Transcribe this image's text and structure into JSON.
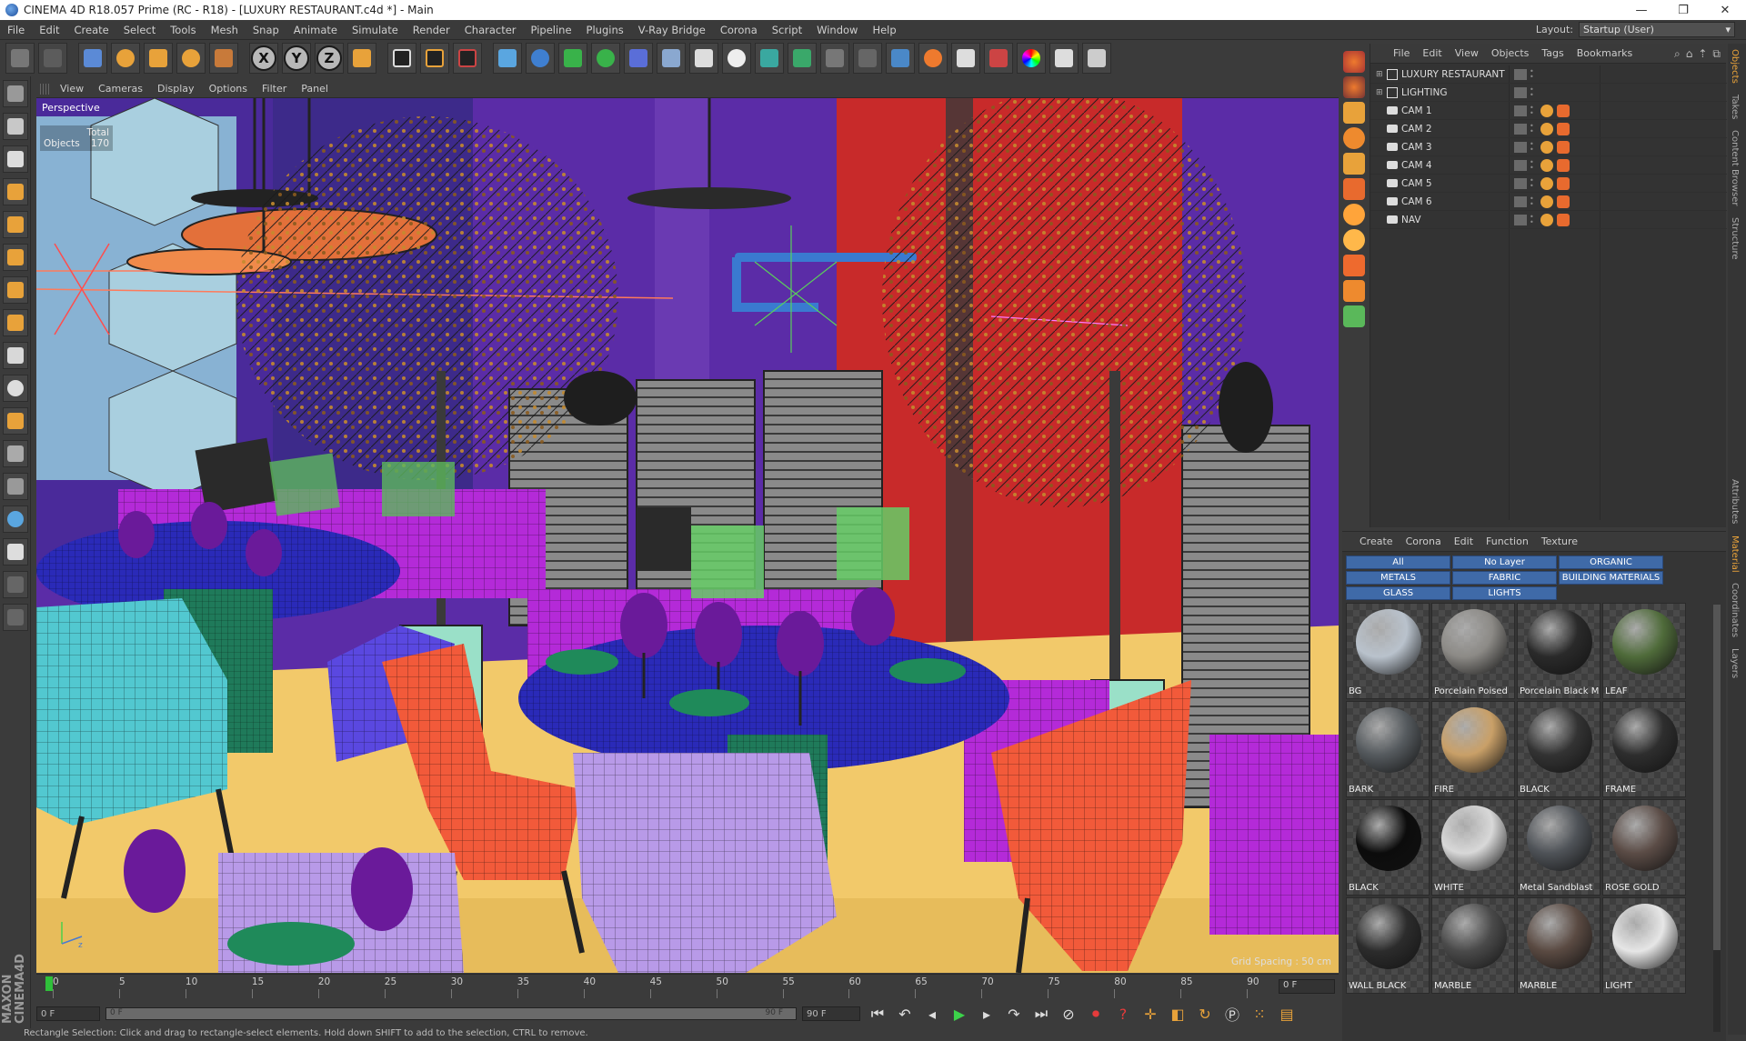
{
  "window": {
    "title": "CINEMA 4D R18.057 Prime (RC - R18) - [LUXURY RESTAURANT.c4d *] - Main",
    "min_glyph": "—",
    "max_glyph": "❐",
    "close_glyph": "✕"
  },
  "menubar": {
    "items": [
      "File",
      "Edit",
      "Create",
      "Select",
      "Tools",
      "Mesh",
      "Snap",
      "Animate",
      "Simulate",
      "Render",
      "Character",
      "Pipeline",
      "Plugins",
      "V-Ray Bridge",
      "Corona",
      "Script",
      "Window",
      "Help"
    ],
    "layout_label": "Layout:",
    "layout_value": "Startup (User)"
  },
  "toolbar": {
    "axis_x": "X",
    "axis_y": "Y",
    "axis_z": "Z"
  },
  "viewport": {
    "menu": [
      "View",
      "Cameras",
      "Display",
      "Options",
      "Filter",
      "Panel"
    ],
    "camera_label": "Perspective",
    "stats_total_label": "Total",
    "stats_objects_label": "Objects",
    "stats_objects_value": "170",
    "grid_spacing": "Grid Spacing : 50 cm"
  },
  "timeline": {
    "ticks": [
      "0",
      "5",
      "10",
      "15",
      "20",
      "25",
      "30",
      "35",
      "40",
      "45",
      "50",
      "55",
      "60",
      "65",
      "70",
      "75",
      "80",
      "85",
      "90"
    ],
    "current_frame": "0 F",
    "start_field": "0 F",
    "range_start": "0 F",
    "range_end": "90 F",
    "end_field": "90 F"
  },
  "status_text": "Rectangle Selection: Click and drag to rectangle-select elements. Hold down SHIFT to add to the selection, CTRL to remove.",
  "object_manager": {
    "menu": [
      "File",
      "Edit",
      "View",
      "Objects",
      "Tags",
      "Bookmarks"
    ],
    "objects": [
      {
        "name": "LUXURY RESTAURANT",
        "type": "null"
      },
      {
        "name": "LIGHTING",
        "type": "null"
      },
      {
        "name": "CAM 1",
        "type": "camera"
      },
      {
        "name": "CAM 2",
        "type": "camera"
      },
      {
        "name": "CAM 3",
        "type": "camera"
      },
      {
        "name": "CAM 4",
        "type": "camera"
      },
      {
        "name": "CAM 5",
        "type": "camera"
      },
      {
        "name": "CAM 6",
        "type": "camera"
      },
      {
        "name": "NAV",
        "type": "camera"
      }
    ]
  },
  "side_tabs": [
    "Objects",
    "Takes",
    "Content Browser",
    "Structure",
    "Attributes",
    "Material",
    "Coordinates",
    "Layers"
  ],
  "material_manager": {
    "menu": [
      "Create",
      "Corona",
      "Edit",
      "Function",
      "Texture"
    ],
    "layers": [
      "All",
      "No Layer",
      "ORGANIC",
      "METALS",
      "FABRIC",
      "BUILDING MATERIALS",
      "GLASS",
      "LIGHTS"
    ],
    "materials": [
      {
        "name": "BG",
        "color": "#b9c2cc"
      },
      {
        "name": "Porcelain Poised",
        "color": "#8c8a86"
      },
      {
        "name": "Porcelain Black M",
        "color": "#2a2a2a"
      },
      {
        "name": "LEAF",
        "color": "#4f6b3a"
      },
      {
        "name": "BARK",
        "color": "#555a5e"
      },
      {
        "name": "FIRE",
        "color": "#c9a068"
      },
      {
        "name": "BLACK",
        "color": "#333333"
      },
      {
        "name": "FRAME",
        "color": "#2e2e2e"
      },
      {
        "name": "BLACK",
        "color": "#0c0c0c"
      },
      {
        "name": "WHITE",
        "color": "#d8d8d8"
      },
      {
        "name": "Metal Sandblast",
        "color": "#4f5358"
      },
      {
        "name": "ROSE GOLD",
        "color": "#5b4c46"
      },
      {
        "name": "WALL BLACK",
        "color": "#2c2c2c"
      },
      {
        "name": "MARBLE",
        "color": "#4a4a4a"
      },
      {
        "name": "MARBLE",
        "color": "#5a4a42"
      },
      {
        "name": "LIGHT",
        "color": "#e6e6e6"
      }
    ]
  }
}
